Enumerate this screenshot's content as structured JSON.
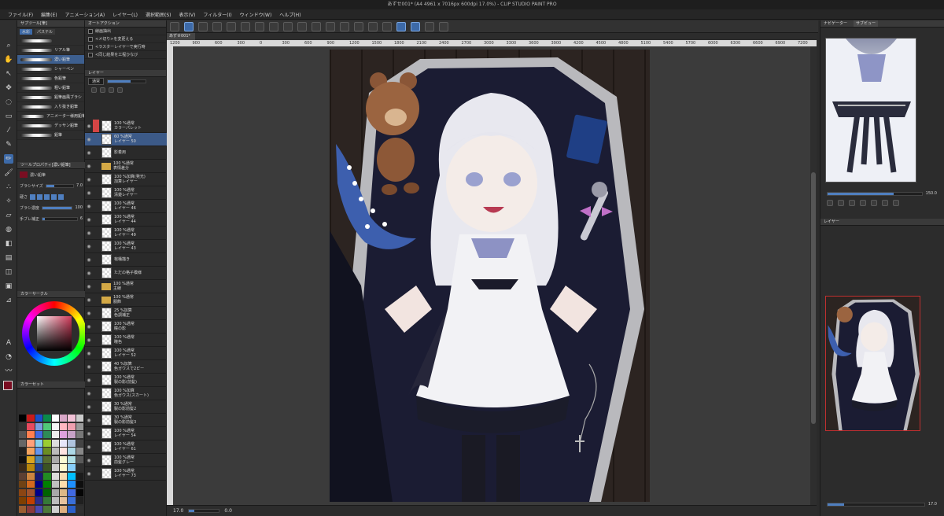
{
  "window": {
    "title": "あずせ001* (A4 4961 x 7016px 600dpi 17.0%) - CLIP STUDIO PAINT PRO"
  },
  "menu": [
    "ファイル(F)",
    "編集(E)",
    "アニメーション(A)",
    "レイヤー(L)",
    "選択範囲(S)",
    "表示(V)",
    "フィルター(I)",
    "ウィンドウ(W)",
    "ヘルプ(H)"
  ],
  "document_tab": "あずせ001*",
  "sub_tool_panel": {
    "tab_label": "サブツール[筆]",
    "group_tabs": [
      "水彩",
      "パステル"
    ],
    "brushes": [
      "",
      "リアル筆",
      "濃い鉛筆",
      "シャーペン",
      "色鉛筆",
      "粗い鉛筆",
      "鉛筆画風ブラシ",
      "入り抜き鉛筆",
      "アニメーター様用鉛筆(拡張)",
      "デッサン鉛筆",
      "鉛筆"
    ],
    "selected_brush_index": 2
  },
  "tool_property": {
    "tab_label": "ツールプロパティ[濃い鉛筆]",
    "tool_name": "濃い鉛筆",
    "brush_size_label": "ブラシサイズ",
    "brush_size_value": "7.0",
    "hardness_label": "硬さ",
    "density_label": "ブラシ濃度",
    "density_value": "100",
    "stabilizer_label": "手ブレ補正",
    "stabilizer_value": "6"
  },
  "auto_actions": {
    "tab_label": "オートアクション",
    "items": [
      "線画抽出",
      "<メ切り>を変更える",
      "<ラスターレイヤーで実行時",
      "<同じ結果を工程ひなび"
    ]
  },
  "layer_panel": {
    "tab_label": "レイヤー",
    "blend_mode": "通常",
    "layers": [
      {
        "opacity": "100 %通常",
        "name": "カラーパレット",
        "marker": true
      },
      {
        "opacity": "60 %通常",
        "name": "レイヤー 50",
        "selected": true
      },
      {
        "opacity": "",
        "name": "影着用"
      },
      {
        "opacity": "100 %通常",
        "name": "表情差分",
        "folder": true
      },
      {
        "opacity": "100 %加算(発光)",
        "name": "加算レイヤー"
      },
      {
        "opacity": "100 %通常",
        "name": "清楚レイヤー"
      },
      {
        "opacity": "100 %通常",
        "name": "レイヤー 46"
      },
      {
        "opacity": "100 %通常",
        "name": "レイヤー 44"
      },
      {
        "opacity": "100 %通常",
        "name": "レイヤー 49"
      },
      {
        "opacity": "100 %通常",
        "name": "レイヤー 43"
      },
      {
        "opacity": "",
        "name": "棺桶描き"
      },
      {
        "opacity": "",
        "name": "ただの格子模様"
      },
      {
        "opacity": "100 %通常",
        "name": "主線",
        "folder": true
      },
      {
        "opacity": "100 %通常",
        "name": "服飾",
        "folder": true
      },
      {
        "opacity": "25 %加算",
        "name": "色調補正"
      },
      {
        "opacity": "100 %通常",
        "name": "瞳の影"
      },
      {
        "opacity": "100 %通常",
        "name": "瞳色"
      },
      {
        "opacity": "100 %通常",
        "name": "レイヤー 52"
      },
      {
        "opacity": "40 %加算",
        "name": "色ガウスで2ピー"
      },
      {
        "opacity": "100 %通常",
        "name": "製の影(前髪)"
      },
      {
        "opacity": "100 %加算",
        "name": "色ガウス(スカート)"
      },
      {
        "opacity": "30 %通常",
        "name": "製の影前髪2"
      },
      {
        "opacity": "30 %通常",
        "name": "製の影前髪3"
      },
      {
        "opacity": "100 %通常",
        "name": "レイヤー 54"
      },
      {
        "opacity": "100 %通常",
        "name": "レイヤー 61"
      },
      {
        "opacity": "100 %通常",
        "name": "前髪グレー"
      },
      {
        "opacity": "100 %通常",
        "name": "レイヤー 73"
      }
    ]
  },
  "navigator": {
    "tab_labels": [
      "ナビゲーター",
      "サブビュー"
    ],
    "zoom_value": "150.0",
    "bottom_zoom": "17.0"
  },
  "layer_property_tab": "レイヤー",
  "color_wheel_tab": "カラーサークル",
  "color_set_tab": "カラーセット",
  "status": {
    "zoom": "17.0",
    "angle": "0.0"
  },
  "ruler_ticks": [
    "1200",
    "900",
    "600",
    "300",
    "0",
    "300",
    "600",
    "900",
    "1200",
    "1500",
    "1800",
    "2100",
    "2400",
    "2700",
    "3000",
    "3300",
    "3600",
    "3900",
    "4200",
    "4500",
    "4800",
    "5100",
    "5400",
    "5700",
    "6000",
    "6300",
    "6600",
    "6900",
    "7200"
  ],
  "colors": {
    "accent": "#3d6aa8",
    "panel": "#2d2d2d",
    "canvas_bg": "#3b3b3b",
    "main_color": "#7a0e22",
    "sub_color": "#ffffff"
  }
}
